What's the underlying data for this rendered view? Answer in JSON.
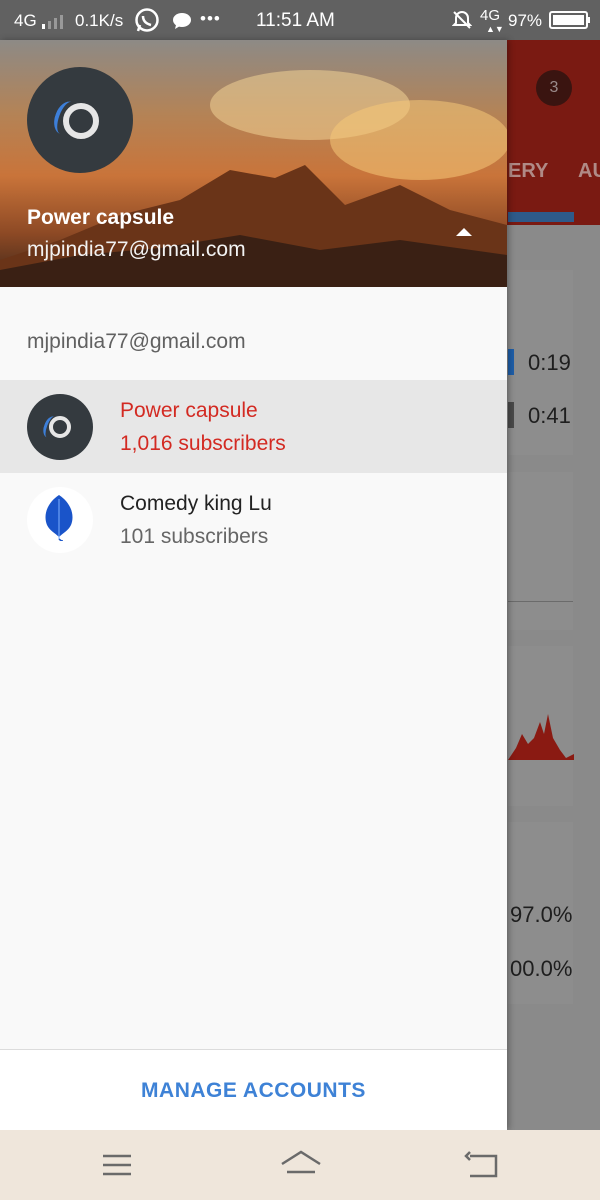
{
  "status_bar": {
    "network_left": "4G",
    "speed": "0.1K/s",
    "more": "•••",
    "time": "11:51 AM",
    "network_right": "4G",
    "battery": "97%"
  },
  "background": {
    "notification_count": "3",
    "tab_partial_1": "ERY",
    "tab_partial_2": "AU",
    "duration_1": "0:19",
    "duration_2": "0:41",
    "percent_1": "97.0%",
    "percent_2": "00.0%"
  },
  "header": {
    "channel_name": "Power capsule",
    "email": "mjpindia77@gmail.com"
  },
  "account": {
    "email": "mjpindia77@gmail.com",
    "channels": [
      {
        "name": "Power capsule",
        "subscribers": "1,016 subscribers",
        "selected": true
      },
      {
        "name": "Comedy king Lu",
        "subscribers": "101 subscribers",
        "selected": false
      }
    ]
  },
  "footer": {
    "manage_label": "MANAGE ACCOUNTS"
  },
  "colors": {
    "accent_red": "#d32a22",
    "link_blue": "#3e82d6"
  }
}
